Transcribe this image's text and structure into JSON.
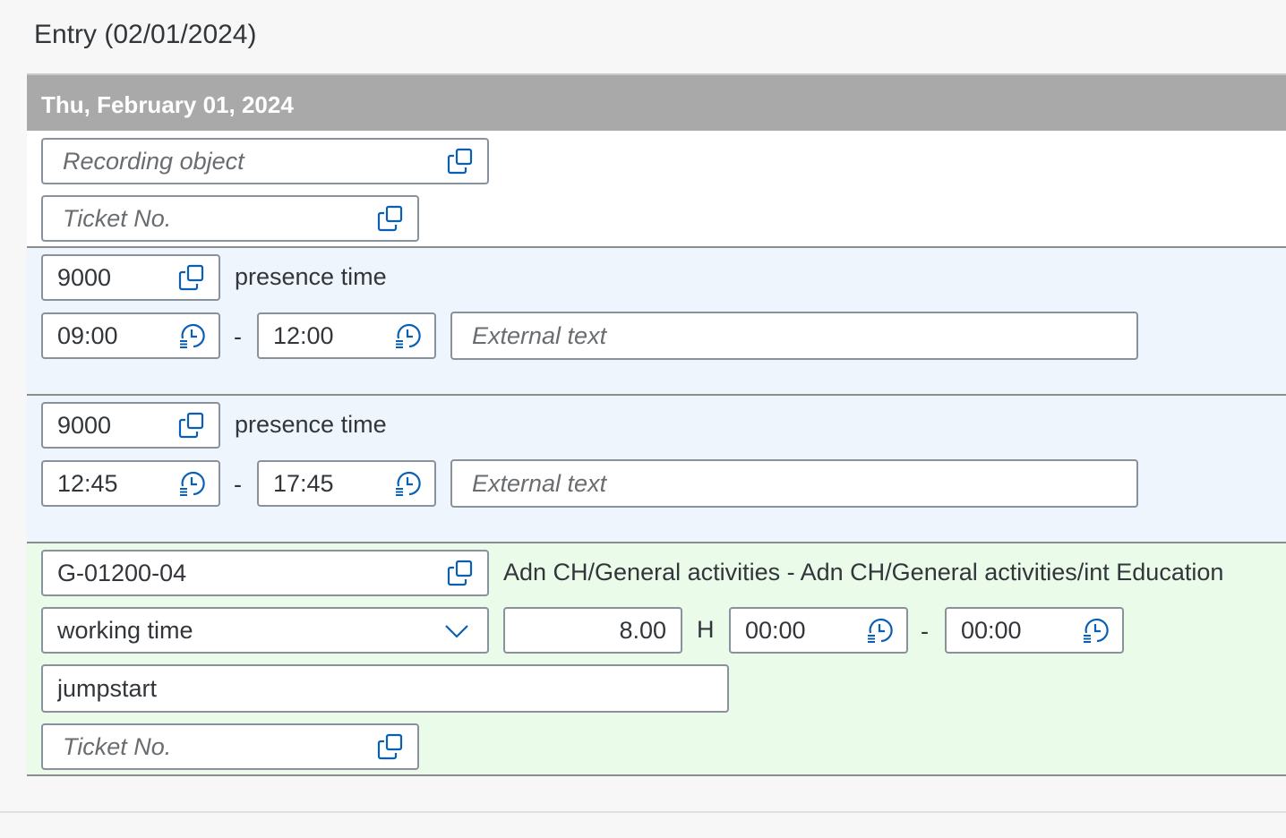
{
  "page": {
    "title": "Entry (02/01/2024)"
  },
  "day": {
    "header": "Thu, February 01, 2024",
    "recording_object_placeholder": "Recording object",
    "ticket_placeholder": "Ticket No."
  },
  "entries": [
    {
      "code": "9000",
      "description": "presence time",
      "start": "09:00",
      "end": "12:00",
      "separator": "-",
      "external_text_placeholder": "External text"
    },
    {
      "code": "9000",
      "description": "presence time",
      "start": "12:45",
      "end": "17:45",
      "separator": "-",
      "external_text_placeholder": "External text"
    },
    {
      "code": "G-01200-04",
      "description": "Adn CH/General activities - Adn CH/General activities/int Education",
      "type": "working time",
      "hours": "8.00",
      "unit": "H",
      "start": "00:00",
      "end": "00:00",
      "separator": "-",
      "text": "jumpstart",
      "ticket_placeholder": "Ticket No."
    }
  ],
  "icons": {
    "value_help": "value-help-icon",
    "time_picker": "clock-icon",
    "dropdown": "chevron-down-icon"
  },
  "colors": {
    "header_bg": "#a9a9a9",
    "presence_bg": "#eff5fc",
    "working_bg": "#eafbe9",
    "icon": "#0a6ed1"
  }
}
